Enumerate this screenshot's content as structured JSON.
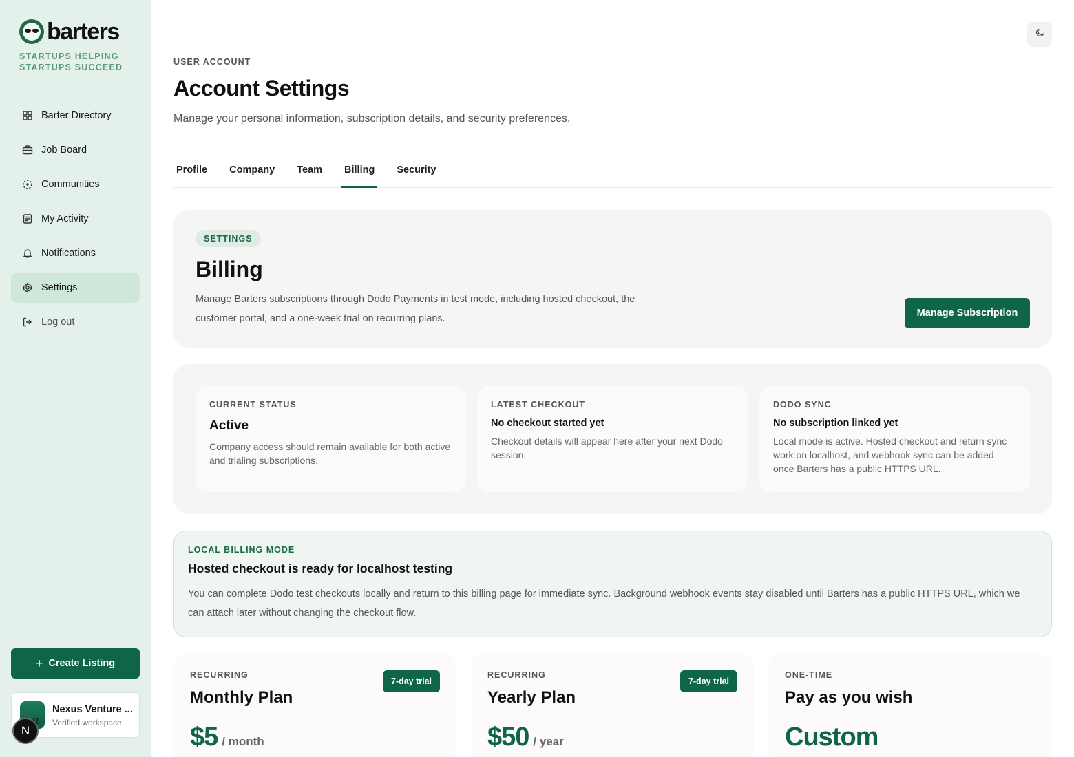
{
  "brand": {
    "name": "barters",
    "tagline": "STARTUPS HELPING STARTUPS SUCCEED"
  },
  "sidebar": {
    "items": [
      {
        "label": "Barter Directory",
        "icon": "grid-icon"
      },
      {
        "label": "Job Board",
        "icon": "briefcase-icon"
      },
      {
        "label": "Communities",
        "icon": "dashed-circle-icon"
      },
      {
        "label": "My Activity",
        "icon": "list-document-icon"
      },
      {
        "label": "Notifications",
        "icon": "bell-icon"
      },
      {
        "label": "Settings",
        "icon": "gear-icon",
        "active": true
      },
      {
        "label": "Log out",
        "icon": "logout-icon"
      }
    ],
    "create_label": "Create Listing",
    "workspace": {
      "initials": "AR",
      "name": "Nexus Venture ...",
      "subtitle": "Verified workspace"
    },
    "badge_letter": "N"
  },
  "header": {
    "eyebrow": "USER ACCOUNT",
    "title": "Account Settings",
    "subtitle": "Manage your personal information, subscription details, and security preferences."
  },
  "tabs": [
    {
      "label": "Profile"
    },
    {
      "label": "Company"
    },
    {
      "label": "Team"
    },
    {
      "label": "Billing",
      "active": true
    },
    {
      "label": "Security"
    }
  ],
  "billing": {
    "pill": "SETTINGS",
    "title": "Billing",
    "description": "Manage Barters subscriptions through Dodo Payments in test mode, including hosted checkout, the customer portal, and a one-week trial on recurring plans.",
    "manage_label": "Manage Subscription"
  },
  "status_cards": [
    {
      "label": "CURRENT STATUS",
      "value": "Active",
      "body": "Company access should remain available for both active and trialing subscriptions."
    },
    {
      "label": "LATEST CHECKOUT",
      "value": "No checkout started yet",
      "body": "Checkout details will appear here after your next Dodo session."
    },
    {
      "label": "DODO SYNC",
      "value": "No subscription linked yet",
      "body": "Local mode is active. Hosted checkout and return sync work on localhost, and webhook sync can be added once Barters has a public HTTPS URL."
    }
  ],
  "local_mode": {
    "label": "LOCAL BILLING MODE",
    "title": "Hosted checkout is ready for localhost testing",
    "body": "You can complete Dodo test checkouts locally and return to this billing page for immediate sync. Background webhook events stay disabled until Barters has a public HTTPS URL, which we can attach later without changing the checkout flow."
  },
  "plans": [
    {
      "label": "RECURRING",
      "name": "Monthly Plan",
      "trial": "7-day trial",
      "price": "$5",
      "period": "/ month"
    },
    {
      "label": "RECURRING",
      "name": "Yearly Plan",
      "trial": "7-day trial",
      "price": "$50",
      "period": "/ year"
    },
    {
      "label": "ONE-TIME",
      "name": "Pay as you wish",
      "price": "Custom"
    }
  ],
  "colors": {
    "accent": "#0f6647",
    "sidebar_bg": "#e3f1ea",
    "active_nav": "#cfe7da"
  }
}
